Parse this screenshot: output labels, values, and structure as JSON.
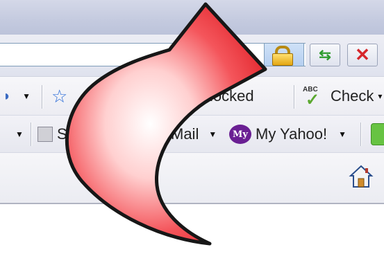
{
  "toolbar": {
    "popup_label": "Blocked",
    "popup_label_partial": "locked",
    "check_label": "Check",
    "check_caret": "▾",
    "abc_text": "ABC"
  },
  "links": {
    "s_label_partial": "S",
    "mail_label": "Mail",
    "myyahoo_icon_text": "My",
    "myyahoo_label": "My Yahoo!"
  },
  "icons": {
    "lock": "lock-icon",
    "go": "go-refresh-icon",
    "stop": "stop-icon",
    "favorites": "favorites-star-icon",
    "spellcheck": "spellcheck-icon",
    "popup_blocker": "popup-blocker-icon",
    "mail": "mail-icon",
    "myyahoo": "myyahoo-icon",
    "home": "home-icon",
    "arrow": "curved-red-arrow"
  },
  "colors": {
    "arrow_fill": "#f2343c",
    "arrow_outline": "#1a1a1a",
    "lock_bg": "#b5cff0",
    "stop_red": "#d6262b",
    "go_green": "#2e9b2e",
    "myyahoo_purple": "#6a1f93"
  }
}
